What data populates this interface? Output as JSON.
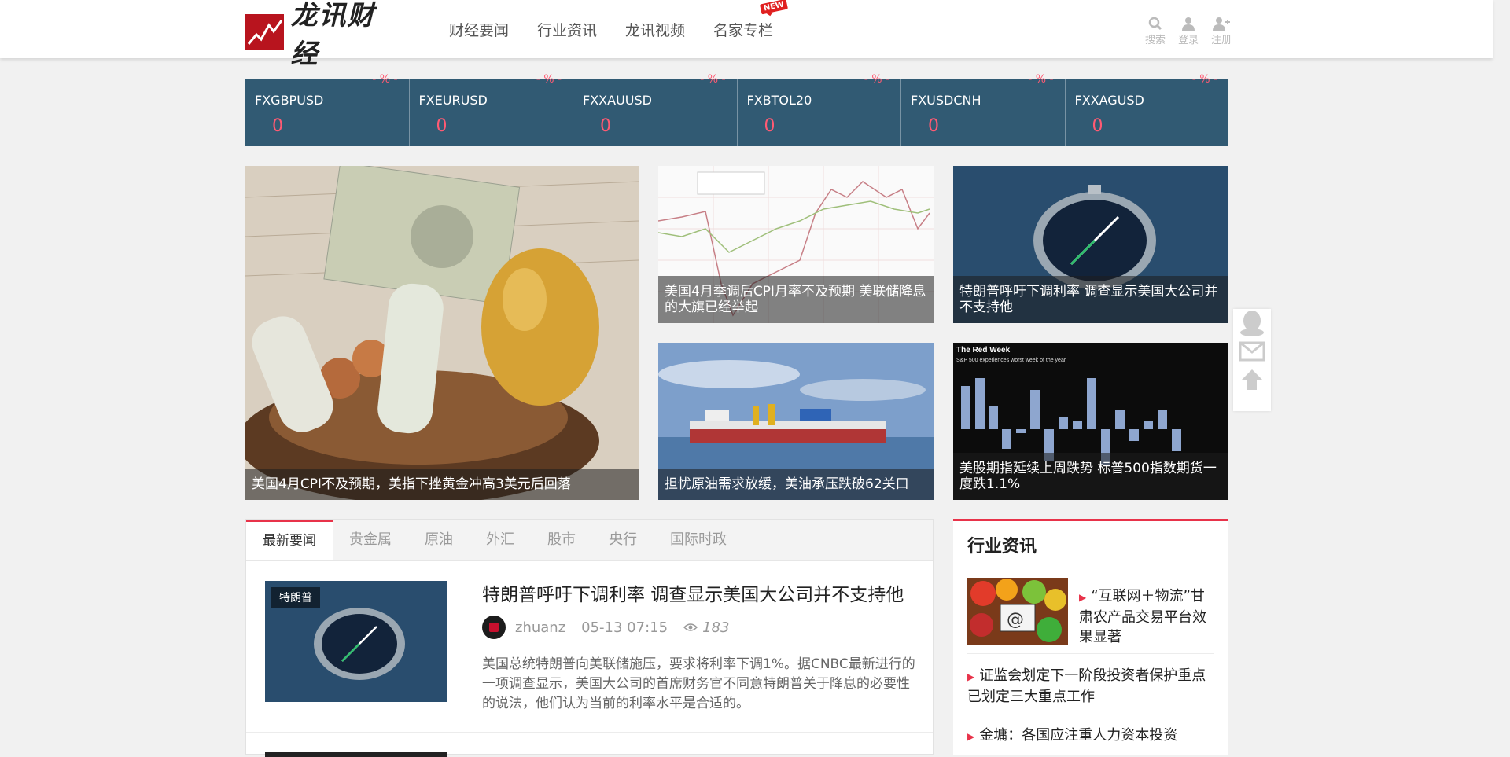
{
  "header": {
    "logo_text": "龙讯财经",
    "nav": [
      "财经要闻",
      "行业资讯",
      "龙讯视频",
      "名家专栏"
    ],
    "new_badge": "NEW",
    "tools": [
      {
        "label": "搜索",
        "icon": "search-icon"
      },
      {
        "label": "登录",
        "icon": "user-icon"
      },
      {
        "label": "注册",
        "icon": "add-user-icon"
      }
    ]
  },
  "ticker": [
    {
      "symbol": "FXGBPUSD",
      "value": "0",
      "change": "- % -"
    },
    {
      "symbol": "FXEURUSD",
      "value": "0",
      "change": "- % -"
    },
    {
      "symbol": "FXXAUUSD",
      "value": "0",
      "change": "- % -"
    },
    {
      "symbol": "FXBTOL20",
      "value": "0",
      "change": "- % -"
    },
    {
      "symbol": "FXUSDCNH",
      "value": "0",
      "change": "- % -"
    },
    {
      "symbol": "FXXAGUSD",
      "value": "0",
      "change": "- % -"
    }
  ],
  "features": {
    "big": "美国4月CPI不及预期，美指下挫黄金冲高3美元后回落",
    "cpi_chart": "美国4月季调后CPI月率不及预期 美联储降息的大旗已经举起",
    "compass": "特朗普呼吁下调利率 调查显示美国大公司并不支持他",
    "oil": "担忧原油需求放缓，美油承压跌破62关口",
    "red_week": "美股期指延续上周跌势 标普500指数期货一度跌1.1%",
    "red_week_img_title": "The Red Week",
    "red_week_img_subtitle": "S&P 500 experiences worst week of the year"
  },
  "tabs": [
    "最新要闻",
    "贵金属",
    "原油",
    "外汇",
    "股市",
    "央行",
    "国际时政"
  ],
  "article": {
    "tag": "特朗普",
    "title": "特朗普呼吁下调利率 调查显示美国大公司并不支持他",
    "author": "zhuanz",
    "time": "05-13 07:15",
    "views": "183",
    "summary": "美国总统特朗普向美联储施压，要求将利率下调1%。据CNBC最新进行的一项调查显示，美国大公司的首席财务官不同意特朗普关于降息的必要性的说法，他们认为当前的利率水平是合适的。"
  },
  "side": {
    "title": "行业资讯",
    "links": [
      "“互联网＋物流”甘肃农产品交易平台效果显著",
      "证监会划定下一阶段投资者保护重点 已划定三大重点工作",
      "金墉：各国应注重人力资本投资"
    ]
  },
  "colors": {
    "accent": "#e8334a",
    "ticker_bg": "#315a73",
    "ticker_value": "#ff5a73"
  }
}
